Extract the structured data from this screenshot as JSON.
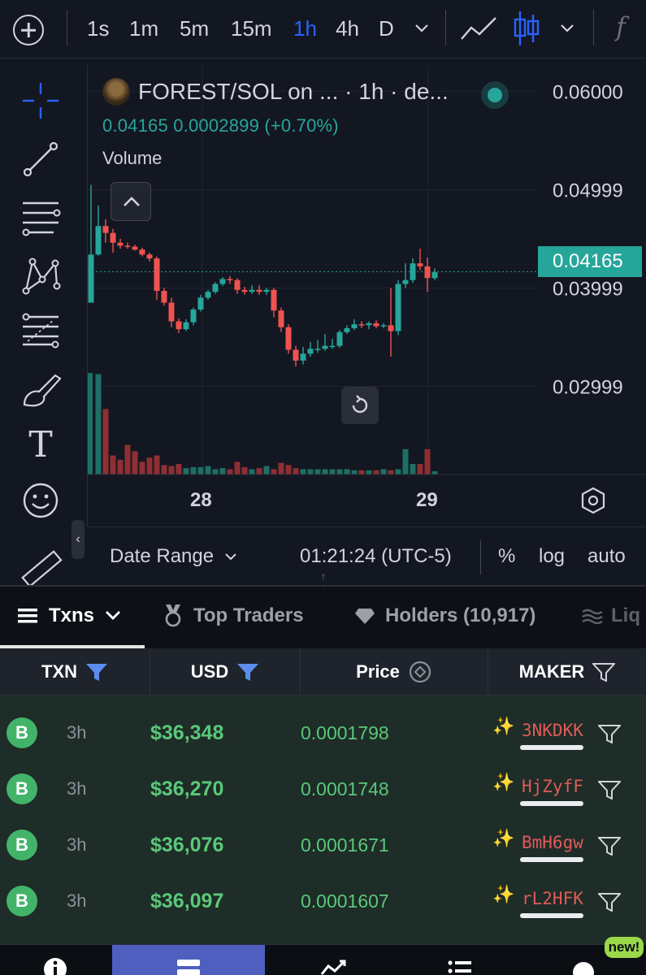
{
  "toolbar": {
    "timeframes": [
      {
        "label": "1s",
        "active": false
      },
      {
        "label": "1m",
        "active": false
      },
      {
        "label": "5m",
        "active": false
      },
      {
        "label": "15m",
        "active": false
      },
      {
        "label": "1h",
        "active": true
      },
      {
        "label": "4h",
        "active": false
      },
      {
        "label": "D",
        "active": false
      }
    ],
    "fx_label": "f"
  },
  "rail": {
    "tools": [
      "crosshair-icon",
      "trend-line-icon",
      "horizontal-lines-icon",
      "pattern-icon",
      "fib-icon",
      "brush-icon",
      "text-icon",
      "emoji-icon",
      "ruler-icon"
    ],
    "text_tool_label": "T"
  },
  "chart": {
    "symbol_line": "FOREST/SOL on ... · 1h · de...",
    "price_line": "0.04165  0.0002899 (+0.70%)",
    "volume_label": "Volume",
    "current_price_label": "0.04165",
    "date_labels": [
      "28",
      "29"
    ],
    "colors": {
      "up": "#26a69a",
      "down": "#ef5350",
      "accent": "#2962ff"
    }
  },
  "chart_data": {
    "type": "candlestick",
    "y_ticks": [
      "0.06000",
      "0.04999",
      "0.03999",
      "0.02999"
    ],
    "ylim": [
      0.021,
      0.0627
    ],
    "current_price": 0.04165,
    "x_labels": [
      "28",
      "29"
    ],
    "candles": [
      {
        "o": 0.0385,
        "h": 0.0505,
        "l": 0.0411,
        "c": 0.0434
      },
      {
        "o": 0.0434,
        "h": 0.0484,
        "l": 0.0433,
        "c": 0.0463
      },
      {
        "o": 0.0463,
        "h": 0.047,
        "l": 0.0446,
        "c": 0.0456
      },
      {
        "o": 0.0456,
        "h": 0.046,
        "l": 0.0436,
        "c": 0.0446
      },
      {
        "o": 0.0446,
        "h": 0.045,
        "l": 0.044,
        "c": 0.0443
      },
      {
        "o": 0.0443,
        "h": 0.0446,
        "l": 0.044,
        "c": 0.0442
      },
      {
        "o": 0.0442,
        "h": 0.0444,
        "l": 0.0438,
        "c": 0.0439
      },
      {
        "o": 0.0439,
        "h": 0.0441,
        "l": 0.0432,
        "c": 0.0434
      },
      {
        "o": 0.0434,
        "h": 0.0436,
        "l": 0.0427,
        "c": 0.043
      },
      {
        "o": 0.043,
        "h": 0.0432,
        "l": 0.0388,
        "c": 0.0397
      },
      {
        "o": 0.0397,
        "h": 0.04,
        "l": 0.0382,
        "c": 0.0385
      },
      {
        "o": 0.0385,
        "h": 0.039,
        "l": 0.036,
        "c": 0.0366
      },
      {
        "o": 0.0366,
        "h": 0.0369,
        "l": 0.0354,
        "c": 0.0358
      },
      {
        "o": 0.0358,
        "h": 0.0368,
        "l": 0.0356,
        "c": 0.0365
      },
      {
        "o": 0.0365,
        "h": 0.038,
        "l": 0.0362,
        "c": 0.0378
      },
      {
        "o": 0.0378,
        "h": 0.0393,
        "l": 0.0376,
        "c": 0.039
      },
      {
        "o": 0.039,
        "h": 0.0398,
        "l": 0.0388,
        "c": 0.0396
      },
      {
        "o": 0.0396,
        "h": 0.0406,
        "l": 0.0394,
        "c": 0.0404
      },
      {
        "o": 0.0404,
        "h": 0.0411,
        "l": 0.0402,
        "c": 0.0409
      },
      {
        "o": 0.0409,
        "h": 0.0412,
        "l": 0.0404,
        "c": 0.0408
      },
      {
        "o": 0.0408,
        "h": 0.041,
        "l": 0.0394,
        "c": 0.0398
      },
      {
        "o": 0.0398,
        "h": 0.0401,
        "l": 0.0393,
        "c": 0.0396
      },
      {
        "o": 0.0396,
        "h": 0.0403,
        "l": 0.0394,
        "c": 0.0398
      },
      {
        "o": 0.0398,
        "h": 0.0403,
        "l": 0.0393,
        "c": 0.0396
      },
      {
        "o": 0.0396,
        "h": 0.04,
        "l": 0.0393,
        "c": 0.0398
      },
      {
        "o": 0.0398,
        "h": 0.04,
        "l": 0.037,
        "c": 0.0377
      },
      {
        "o": 0.0377,
        "h": 0.038,
        "l": 0.0355,
        "c": 0.036
      },
      {
        "o": 0.036,
        "h": 0.0363,
        "l": 0.0333,
        "c": 0.0337
      },
      {
        "o": 0.0337,
        "h": 0.0341,
        "l": 0.032,
        "c": 0.0326
      },
      {
        "o": 0.0326,
        "h": 0.034,
        "l": 0.0322,
        "c": 0.0333
      },
      {
        "o": 0.0333,
        "h": 0.0345,
        "l": 0.033,
        "c": 0.0338
      },
      {
        "o": 0.0338,
        "h": 0.0347,
        "l": 0.0334,
        "c": 0.0338
      },
      {
        "o": 0.0338,
        "h": 0.0353,
        "l": 0.0336,
        "c": 0.0341
      },
      {
        "o": 0.0341,
        "h": 0.0348,
        "l": 0.0338,
        "c": 0.0341
      },
      {
        "o": 0.0341,
        "h": 0.0357,
        "l": 0.0339,
        "c": 0.0355
      },
      {
        "o": 0.0355,
        "h": 0.0362,
        "l": 0.0353,
        "c": 0.0359
      },
      {
        "o": 0.0359,
        "h": 0.0368,
        "l": 0.0357,
        "c": 0.0363
      },
      {
        "o": 0.0363,
        "h": 0.0366,
        "l": 0.0359,
        "c": 0.0362
      },
      {
        "o": 0.0362,
        "h": 0.0366,
        "l": 0.0358,
        "c": 0.0364
      },
      {
        "o": 0.0364,
        "h": 0.0367,
        "l": 0.0359,
        "c": 0.0361
      },
      {
        "o": 0.0361,
        "h": 0.0364,
        "l": 0.0359,
        "c": 0.0362
      },
      {
        "o": 0.0362,
        "h": 0.04,
        "l": 0.033,
        "c": 0.0356
      },
      {
        "o": 0.0356,
        "h": 0.0408,
        "l": 0.0352,
        "c": 0.0404
      },
      {
        "o": 0.0404,
        "h": 0.0425,
        "l": 0.04,
        "c": 0.0408
      },
      {
        "o": 0.0408,
        "h": 0.043,
        "l": 0.0405,
        "c": 0.0425
      },
      {
        "o": 0.0425,
        "h": 0.044,
        "l": 0.0418,
        "c": 0.0422
      },
      {
        "o": 0.0422,
        "h": 0.0431,
        "l": 0.0396,
        "c": 0.041
      },
      {
        "o": 0.041,
        "h": 0.042,
        "l": 0.0408,
        "c": 0.0416
      }
    ],
    "volume_rel": [
      0.0,
      0.95,
      0.62,
      0.18,
      0.14,
      0.28,
      0.22,
      0.12,
      0.16,
      0.18,
      0.09,
      0.08,
      0.1,
      0.06,
      0.07,
      0.07,
      0.08,
      0.05,
      0.06,
      0.05,
      0.12,
      0.07,
      0.05,
      0.06,
      0.08,
      0.05,
      0.11,
      0.09,
      0.06,
      0.05,
      0.05,
      0.05,
      0.05,
      0.05,
      0.05,
      0.05,
      0.04,
      0.04,
      0.04,
      0.04,
      0.05,
      0.04,
      0.05,
      0.24,
      0.1,
      0.1,
      0.24,
      0.03
    ]
  },
  "chart_footer": {
    "date_range_label": "Date Range",
    "clock": "01:21:24 (UTC-5)",
    "percent_label": "%",
    "log_label": "log",
    "auto_label": "auto"
  },
  "tabs": {
    "txns": "Txns",
    "top_traders": "Top Traders",
    "holders": "Holders (10,917)",
    "liquidity": "Liq"
  },
  "table": {
    "headers": {
      "txn": "TXN",
      "usd": "USD",
      "price": "Price",
      "maker": "MAKER"
    },
    "rows": [
      {
        "type": "B",
        "age": "3h",
        "usd": "$36,348",
        "price": "0.0001798",
        "maker": "3NKDKK"
      },
      {
        "type": "B",
        "age": "3h",
        "usd": "$36,270",
        "price": "0.0001748",
        "maker": "HjZyfF"
      },
      {
        "type": "B",
        "age": "3h",
        "usd": "$36,076",
        "price": "0.0001671",
        "maker": "BmH6gw"
      },
      {
        "type": "B",
        "age": "3h",
        "usd": "$36,097",
        "price": "0.0001607",
        "maker": "rL2HFK"
      }
    ]
  },
  "bottom_nav": {
    "items": [
      "info-icon",
      "transactions-icon",
      "chart-icon",
      "list-icon",
      "chat-icon"
    ],
    "new_badge": "new!"
  }
}
